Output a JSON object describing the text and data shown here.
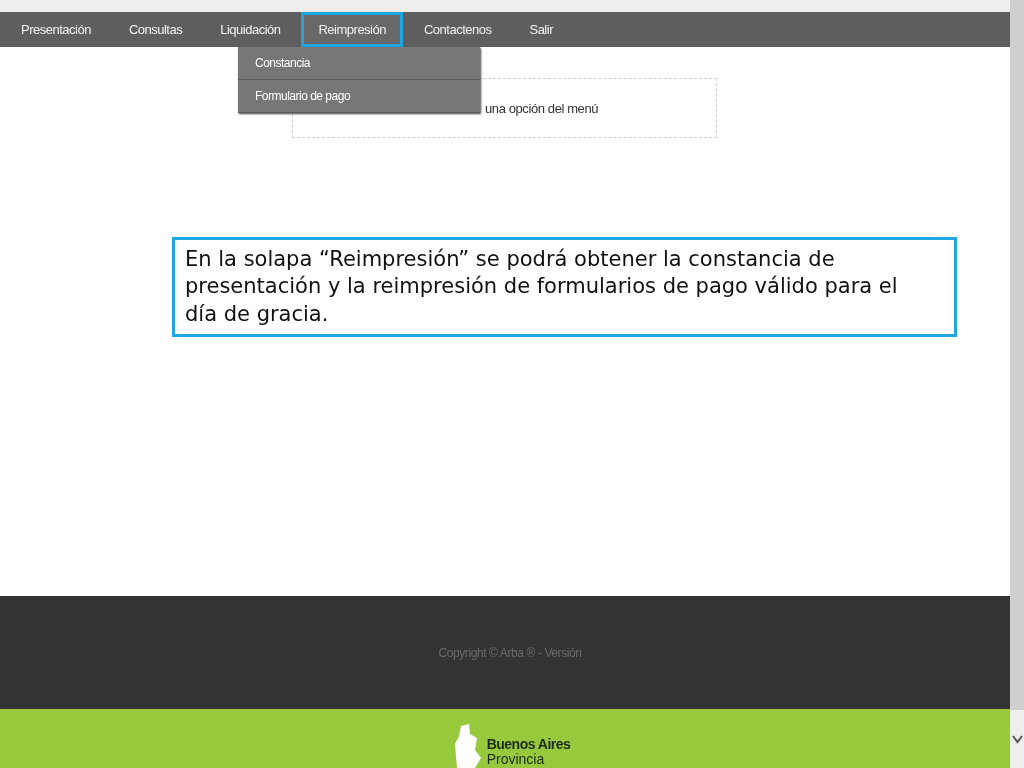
{
  "nav": {
    "items": [
      {
        "label": "Presentación",
        "selected": false
      },
      {
        "label": "Consultas",
        "selected": false
      },
      {
        "label": "Liquidación",
        "selected": false
      },
      {
        "label": "Reimpresión",
        "selected": true
      },
      {
        "label": "Contactenos",
        "selected": false
      },
      {
        "label": "Salir",
        "selected": false
      }
    ],
    "dropdown": [
      "Constancia",
      "Formulario de pago"
    ]
  },
  "content": {
    "message": "una opción del menú"
  },
  "callout": "En la solapa “Reimpresión” se podrá obtener la constancia de presentación y la reimpresión de formularios de pago válido para el día de gracia.",
  "footer": {
    "copyright": "Copyright © Arba ® - Versión",
    "logo_line_1": "Buenos Aires",
    "logo_line_2": "Provincia"
  }
}
